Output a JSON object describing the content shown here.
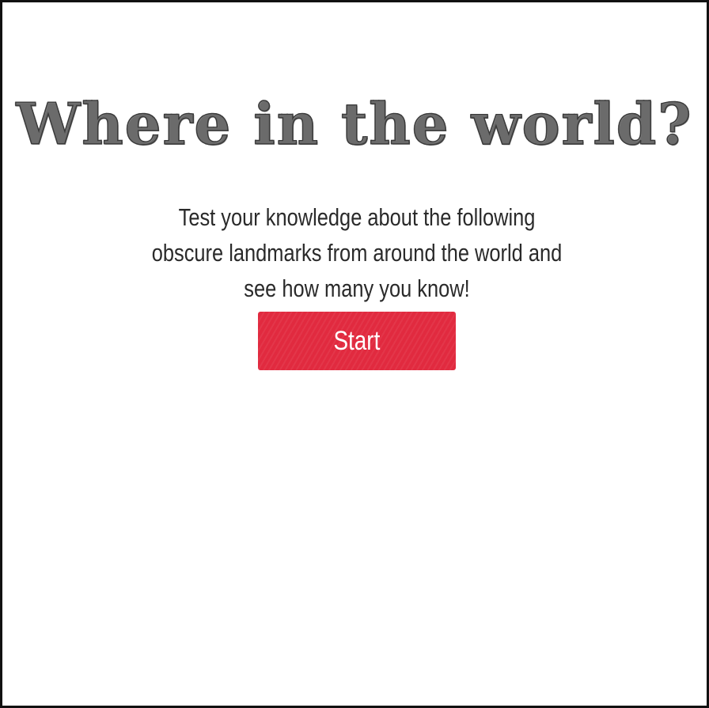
{
  "page": {
    "title": "Where in the world?",
    "intro_text": "Test your knowledge about the following obscure landmarks from around the world and see how many you know!",
    "start_label": "Start"
  },
  "colors": {
    "border": "#111111",
    "title_ink": "#2b2b2b",
    "text": "#2a2a2a",
    "start_button_bg": "#e12a3f",
    "start_button_text": "#ffffff",
    "background": "#ffffff"
  }
}
